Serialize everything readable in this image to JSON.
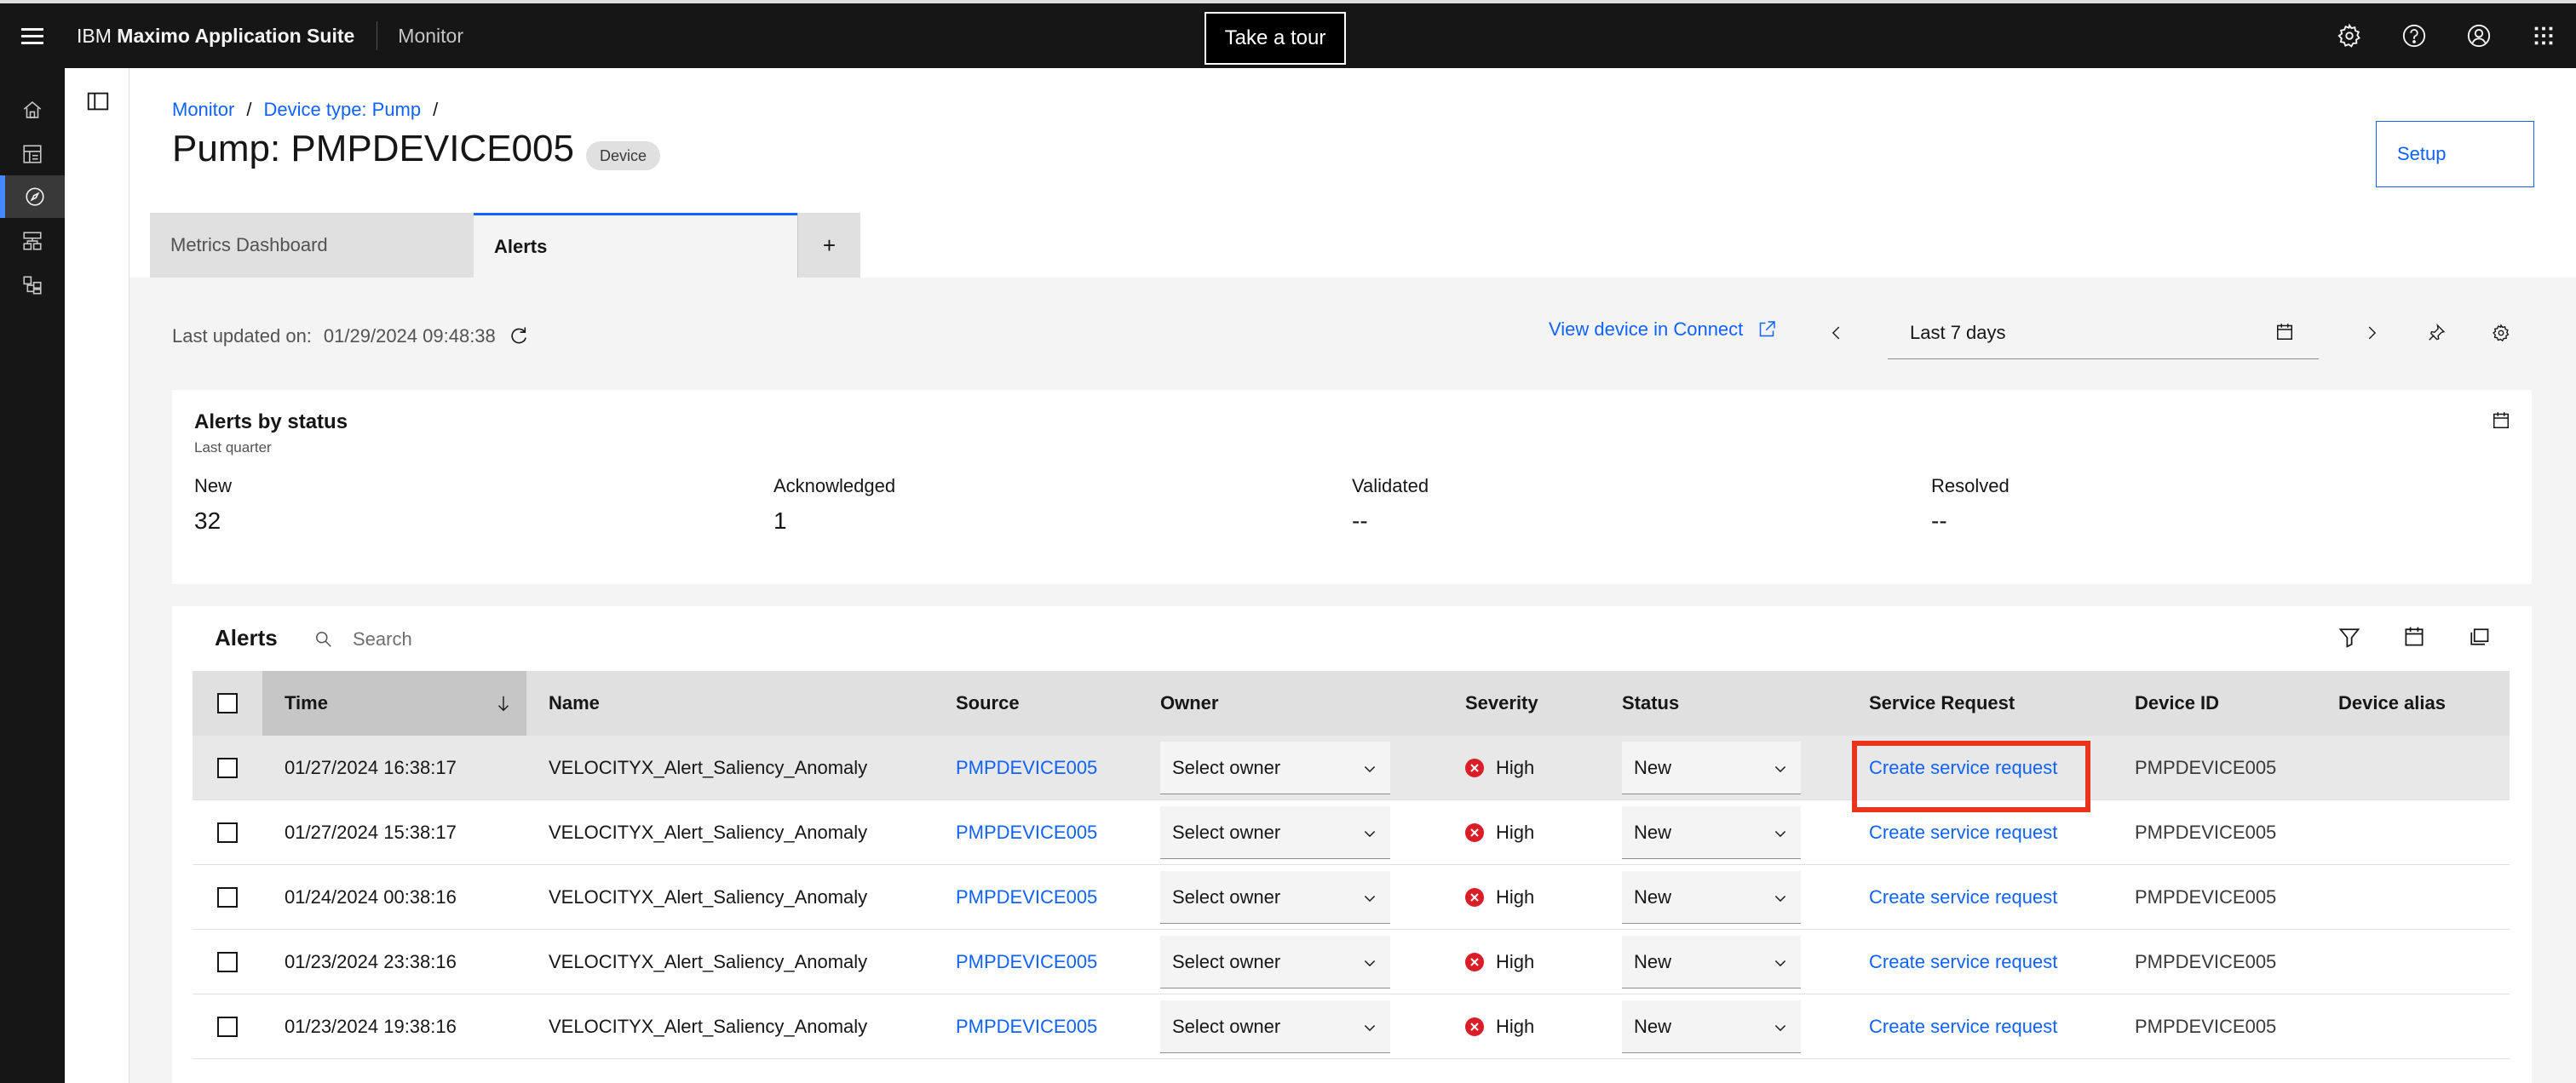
{
  "header": {
    "brand_prefix": "IBM",
    "brand_name": "Maximo Application Suite",
    "app_name": "Monitor",
    "tour_button": "Take a tour"
  },
  "breadcrumb": [
    {
      "label": "Monitor"
    },
    {
      "label": "Device type: Pump"
    }
  ],
  "breadcrumb_sep": "/",
  "page": {
    "title": "Pump: PMPDEVICE005",
    "tag": "Device",
    "setup_button": "Setup"
  },
  "tabs": [
    {
      "label": "Metrics Dashboard"
    },
    {
      "label": "Alerts"
    },
    {
      "label": "+"
    }
  ],
  "toolbar": {
    "updated_label": "Last updated on:",
    "updated_value": "01/29/2024 09:48:38",
    "connect_link": "View device in Connect",
    "date_range": "Last 7 days"
  },
  "status_card": {
    "title": "Alerts by status",
    "subtitle": "Last quarter",
    "stats": [
      {
        "label": "New",
        "value": "32"
      },
      {
        "label": "Acknowledged",
        "value": "1"
      },
      {
        "label": "Validated",
        "value": "--"
      },
      {
        "label": "Resolved",
        "value": "--"
      }
    ]
  },
  "alerts": {
    "title": "Alerts",
    "search_placeholder": "Search",
    "columns": [
      "Time",
      "Name",
      "Source",
      "Owner",
      "Severity",
      "Status",
      "Service Request",
      "Device ID",
      "Device alias"
    ],
    "rows": [
      {
        "time": "01/27/2024 16:38:17",
        "name": "VELOCITYX_Alert_Saliency_Anomaly",
        "source": "PMPDEVICE005",
        "owner": "Select owner",
        "severity": "High",
        "status": "New",
        "service_request": "Create service request",
        "device_id": "PMPDEVICE005",
        "device_alias": ""
      },
      {
        "time": "01/27/2024 15:38:17",
        "name": "VELOCITYX_Alert_Saliency_Anomaly",
        "source": "PMPDEVICE005",
        "owner": "Select owner",
        "severity": "High",
        "status": "New",
        "service_request": "Create service request",
        "device_id": "PMPDEVICE005",
        "device_alias": ""
      },
      {
        "time": "01/24/2024 00:38:16",
        "name": "VELOCITYX_Alert_Saliency_Anomaly",
        "source": "PMPDEVICE005",
        "owner": "Select owner",
        "severity": "High",
        "status": "New",
        "service_request": "Create service request",
        "device_id": "PMPDEVICE005",
        "device_alias": ""
      },
      {
        "time": "01/23/2024 23:38:16",
        "name": "VELOCITYX_Alert_Saliency_Anomaly",
        "source": "PMPDEVICE005",
        "owner": "Select owner",
        "severity": "High",
        "status": "New",
        "service_request": "Create service request",
        "device_id": "PMPDEVICE005",
        "device_alias": ""
      },
      {
        "time": "01/23/2024 19:38:16",
        "name": "VELOCITYX_Alert_Saliency_Anomaly",
        "source": "PMPDEVICE005",
        "owner": "Select owner",
        "severity": "High",
        "status": "New",
        "service_request": "Create service request",
        "device_id": "PMPDEVICE005",
        "device_alias": ""
      }
    ]
  },
  "colors": {
    "accent": "#0f62fe",
    "header_bg": "#161616",
    "severity_high": "#da1e28",
    "highlight_box": "#e8341c"
  },
  "icons": {
    "header": [
      "menu-icon",
      "settings-icon",
      "help-icon",
      "user-avatar-icon",
      "app-switcher-icon"
    ],
    "rail": [
      "home-icon",
      "dashboard-icon",
      "monitor-compass-icon",
      "setup-tree-icon",
      "hierarchy-icon"
    ],
    "toolbar": [
      "refresh-icon",
      "launch-icon",
      "chevron-left-icon",
      "calendar-icon",
      "chevron-right-icon",
      "pin-icon",
      "settings-icon"
    ],
    "table": [
      "search-icon",
      "filter-icon",
      "calendar-icon",
      "copy-icon"
    ]
  }
}
